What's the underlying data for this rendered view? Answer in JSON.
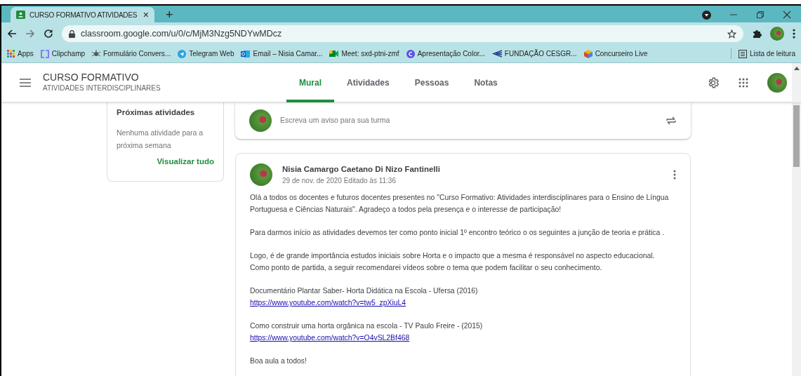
{
  "browser": {
    "tab": {
      "title": "CURSO FORMATIVO ATIVIDADES",
      "close": "×"
    },
    "new_tab": "+",
    "url": "classroom.google.com/u/0/c/MjM3Nzg5NDYwMDcz",
    "bookmarks": [
      {
        "label": "Apps"
      },
      {
        "label": "Clipchamp"
      },
      {
        "label": "Formulário Convers..."
      },
      {
        "label": "Telegram Web"
      },
      {
        "label": "Email – Nisia Camar..."
      },
      {
        "label": "Meet: sxd-ptni-zmf"
      },
      {
        "label": "Apresentação Color..."
      },
      {
        "label": "FUNDAÇÃO CESGR..."
      },
      {
        "label": "Concurseiro Live"
      }
    ],
    "reading_list": "Lista de leitura"
  },
  "header": {
    "title": "CURSO FORMATIVO",
    "subtitle": "ATIVIDADES INTERDISCIPLINARES",
    "tabs": [
      {
        "label": "Mural",
        "selected": true
      },
      {
        "label": "Atividades",
        "selected": false
      },
      {
        "label": "Pessoas",
        "selected": false
      },
      {
        "label": "Notas",
        "selected": false
      }
    ]
  },
  "upcoming": {
    "title": "Próximas atividades",
    "message": "Nenhuma atividade para a próxima semana",
    "link": "Visualizar tudo"
  },
  "composer": {
    "placeholder": "Escreva um aviso para sua turma"
  },
  "post": {
    "author": "Nisia Camargo Caetano Di Nizo Fantinelli",
    "meta": "29 de nov. de 2020 Editado às 11:36",
    "paragraphs": [
      [
        {
          "kind": "text",
          "text": "Olá a todos os docentes e futuros docentes presentes no \"Curso Formativo: Atividades interdisciplinares para o Ensino de Língua Portuguesa e Ciências Naturais\". Agradeço a todos pela presença e o interesse de participação!"
        }
      ],
      [
        {
          "kind": "text",
          "text": "Para darmos início as atividades devemos ter como ponto inicial 1º encontro teórico o os seguintes a junção de teoria e prática ."
        }
      ],
      [
        {
          "kind": "text",
          "text": "Logo, é de grande importância estudos iniciais sobre Horta e o impacto que a mesma é responsável no aspecto educacional. Como ponto de partida, a seguir recomendarei vídeos sobre o tema que podem facilitar o seu conhecimento."
        }
      ],
      [
        {
          "kind": "text",
          "text": "Documentário Plantar Saber- Horta Didática na Escola - Ufersa (2016)"
        },
        {
          "kind": "link",
          "text": "https://www.youtube.com/watch?v=tw5_zpXiuL4"
        }
      ],
      [
        {
          "kind": "text",
          "text": "Como construir uma horta orgânica na escola - TV Paulo Freire - (2015)"
        },
        {
          "kind": "link",
          "text": "https://www.youtube.com/watch?v=O4vSL2Bf468"
        }
      ],
      [
        {
          "kind": "text",
          "text": "Boa aula a todos!"
        }
      ]
    ]
  }
}
